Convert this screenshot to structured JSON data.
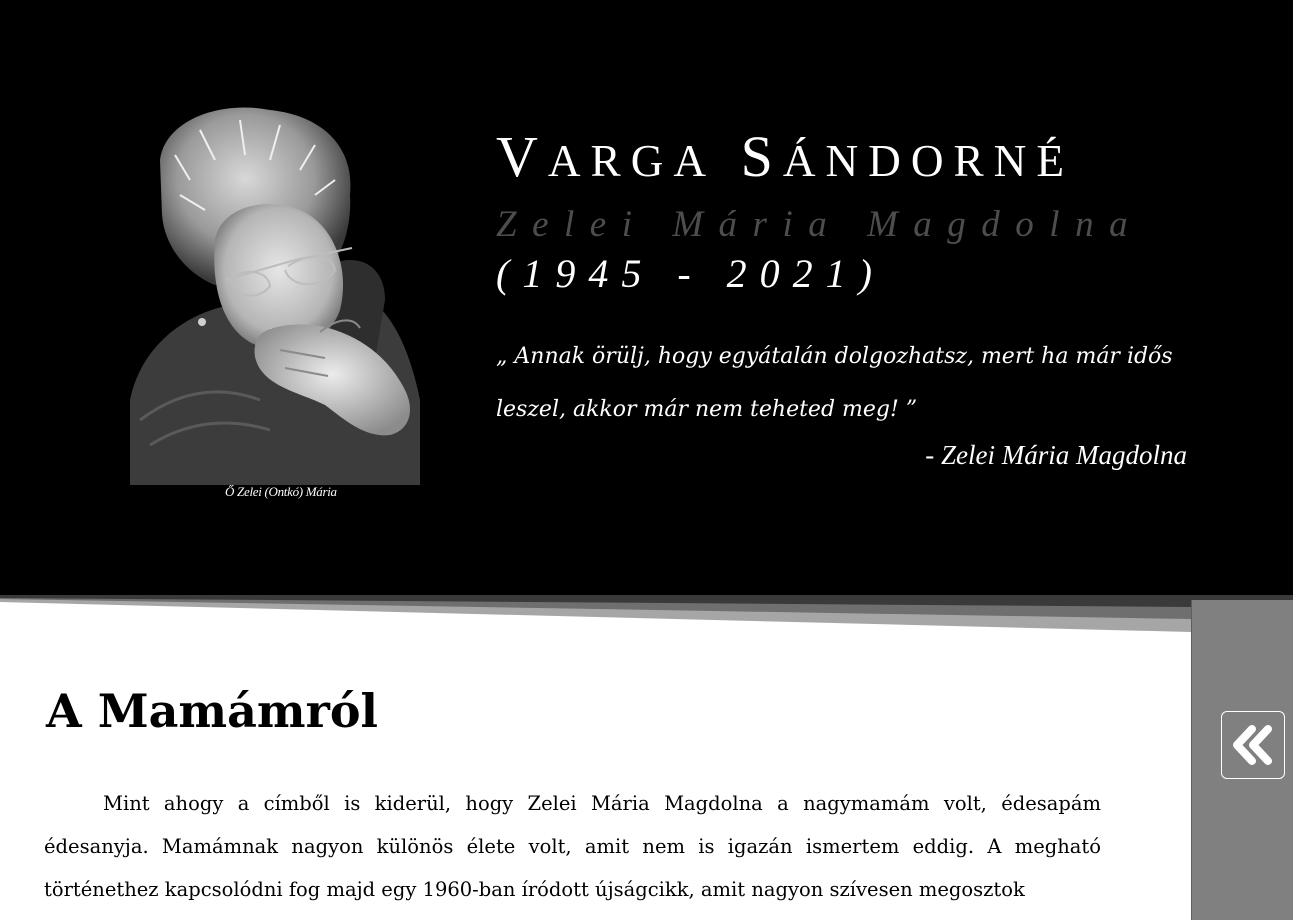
{
  "hero": {
    "title": "Varga Sándorné",
    "subtitle": "Zelei Mária Magdolna",
    "years": "(1945 - 2021)",
    "quote": "„ Annak örülj, hogy egyátalán dolgozhatsz, mert ha már idős leszel, akkor már nem teheted meg! ”",
    "quote_author": "- Zelei Mária Magdolna",
    "photo_caption": "Ő Zelei (Ontkó) Mária"
  },
  "article": {
    "heading": "A Mamámról",
    "paragraph": "Mint ahogy a címből is kiderül, hogy Zelei Mária Magdolna a nagymamám volt, édesapám édesanyja. Mamámnak nagyon különös élete volt, amit nem is igazán ismertem eddig. A megható történethez kapcsolódni fog majd egy 1960-ban íródott újságcikk, amit nagyon szívesen megosztok"
  },
  "sidebar": {
    "toggle_icon": "double-chevron-left-icon"
  },
  "colors": {
    "hero_background": "#000000",
    "subtitle": "#4d4d4d",
    "sidebar": "#808080"
  }
}
